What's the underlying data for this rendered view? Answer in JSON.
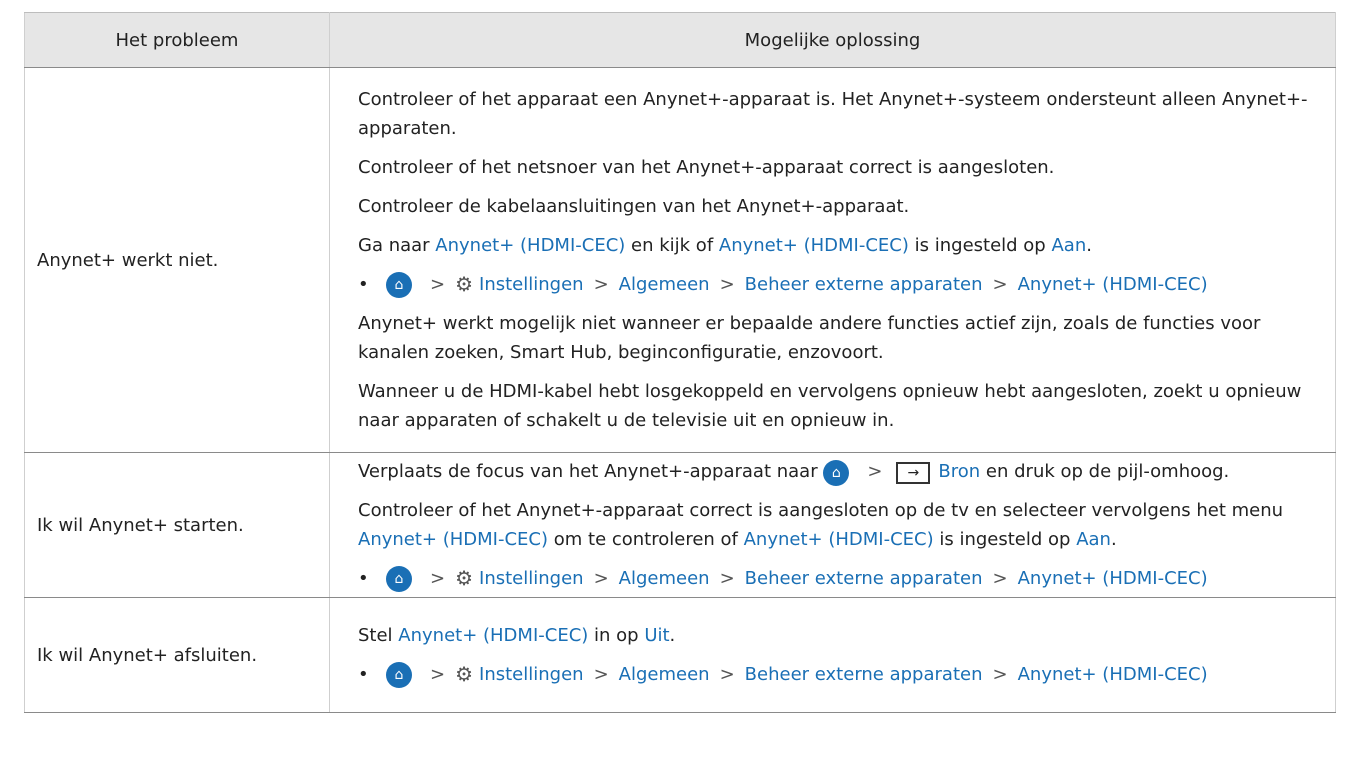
{
  "table": {
    "headers": [
      "Het probleem",
      "Mogelijke oplossing"
    ],
    "rows": [
      {
        "problem": "Anynet+ werkt niet.",
        "p1": "Controleer of het apparaat een Anynet+-apparaat is. Het Anynet+-systeem ondersteunt alleen Anynet+-apparaten.",
        "p2": "Controleer of het netsnoer van het Anynet+-apparaat correct is aangesloten.",
        "p3": "Controleer de kabelaansluitingen van het Anynet+-apparaat.",
        "p4a": "Ga naar ",
        "p4b": "Anynet+ (HDMI-CEC)",
        "p4c": " en kijk of ",
        "p4d": "Anynet+ (HDMI-CEC)",
        "p4e": " is ingesteld op ",
        "p4f": "Aan",
        "p4g": ".",
        "p5": "Anynet+ werkt mogelijk niet wanneer er bepaalde andere functies actief zijn, zoals de functies voor kanalen zoeken, Smart Hub, beginconfiguratie, enzovoort.",
        "p6": "Wanneer u de HDMI-kabel hebt losgekoppeld en vervolgens opnieuw hebt aangesloten, zoekt u opnieuw naar apparaten of schakelt u de televisie uit en opnieuw in."
      },
      {
        "problem": "Ik wil Anynet+ starten.",
        "p1a": "Verplaats de focus van het Anynet+-apparaat naar ",
        "p1b": "Bron",
        "p1c": " en druk op de pijl-omhoog.",
        "p2a": "Controleer of het Anynet+-apparaat correct is aangesloten op de tv en selecteer vervolgens het menu ",
        "p2b": "Anynet+ (HDMI-CEC)",
        "p2c": " om te controleren of ",
        "p2d": "Anynet+ (HDMI-CEC)",
        "p2e": " is ingesteld op ",
        "p2f": "Aan",
        "p2g": "."
      },
      {
        "problem": "Ik wil Anynet+ afsluiten.",
        "p1a": "Stel ",
        "p1b": "Anynet+ (HDMI-CEC)",
        "p1c": " in op ",
        "p1d": "Uit",
        "p1e": "."
      }
    ]
  },
  "menu_path": {
    "bullet": "•",
    "sep": ">",
    "items": [
      "Instellingen",
      "Algemeen",
      "Beheer externe apparaten",
      "Anynet+ (HDMI-CEC)"
    ]
  },
  "icons": {
    "home": "home-icon",
    "settings": "gear-icon",
    "source": "source-icon"
  },
  "colors": {
    "accent": "#1a6fb5",
    "header_bg": "#e6e6e6"
  }
}
